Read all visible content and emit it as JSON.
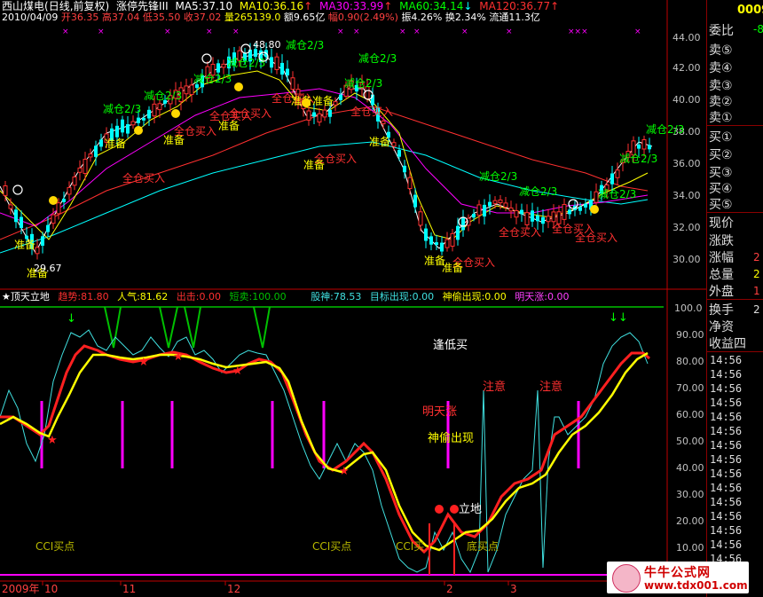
{
  "header": {
    "stock_name": "西山煤电",
    "period": "(日线,前复权)",
    "formula": "涨停先锋III",
    "ma5": "MA5:37.10",
    "ma10": "MA10:36.16",
    "ma30": "MA30:33.99",
    "ma60": "MA60:34.14",
    "ma120": "MA120:36.77",
    "arrow_up": "↑",
    "arrow_down": "↓",
    "date": "2010/04/09",
    "open": "开36.35",
    "high": "高37.04",
    "low": "低35.50",
    "close": "收37.02",
    "volume": "量265139.0",
    "amount": "额9.65亿",
    "change": "幅0.90(2.49%)",
    "amplitude": "振4.26%",
    "turnover": "换2.34%",
    "float": "流通11.3亿",
    "code": "0009"
  },
  "indicator": {
    "title": "顶天立地",
    "star": "★",
    "trend": "趋势:81.80",
    "popularity": "人气:81.62",
    "exit": "出击:0.00",
    "short_sell": "短卖:100.00",
    "stock_god": "股神:78.53",
    "target": "目标出现:0.00",
    "sneak": "神偷出现:0.00",
    "tomorrow": "明天涨:0.00"
  },
  "price_axis": [
    "44.00",
    "42.00",
    "40.00",
    "38.00",
    "36.00",
    "34.00",
    "32.00",
    "30.00"
  ],
  "ind_axis": [
    "100.0",
    "90.00",
    "80.00",
    "70.00",
    "60.00",
    "50.00",
    "40.00",
    "30.00",
    "20.00",
    "10.00"
  ],
  "date_axis": [
    "2009年",
    "10",
    "11",
    "12",
    "2",
    "3"
  ],
  "annotations": {
    "reduce": "减仓2/3",
    "full_buy": "全仓买入",
    "prepare": "准备",
    "high_label": "48.80",
    "low_label": "29.67",
    "low_buy": "逢低买",
    "attention": "注意",
    "tomorrow_rise": "明天涨",
    "sneak_appear": "神偷出现",
    "stand": "立地",
    "cci_buy": "CCI买点",
    "cci_buy2": "CCI买",
    "bottom_buy": "底买点"
  },
  "right_panel": {
    "weibi": "委比",
    "weibi_val": "-8",
    "sell": [
      "卖⑤",
      "卖④",
      "卖③",
      "卖②",
      "卖①"
    ],
    "buy": [
      "买①",
      "买②",
      "买③",
      "买④",
      "买⑤"
    ],
    "stats": [
      "现价",
      "涨跌",
      "涨幅",
      "总量",
      "外盘",
      "换手",
      "净资",
      "收益四"
    ],
    "stats_vals": [
      "",
      "",
      "2",
      "2",
      "1",
      "2",
      "",
      ""
    ],
    "times": [
      "14:56",
      "14:56",
      "14:56",
      "14:56",
      "14:56",
      "14:56",
      "14:56",
      "14:56",
      "14:56",
      "14:56",
      "14:56",
      "14:56",
      "14:56",
      "14:56",
      "14:56",
      "14:57"
    ]
  },
  "watermark": {
    "title": "牛牛公式网",
    "url": "www.tdx001.com"
  },
  "colors": {
    "up": "#ff3030",
    "down": "#00ffff",
    "ma5": "#ffffff",
    "ma10": "#ffff00",
    "ma30": "#ff00ff",
    "ma60": "#00ff00",
    "ma120": "#ff3030",
    "axis": "#c00000"
  }
}
